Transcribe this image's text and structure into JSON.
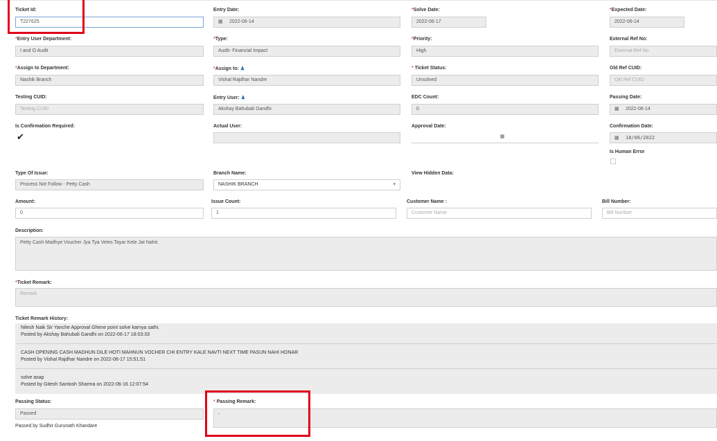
{
  "fields": {
    "ticket_id": {
      "label": "Ticket Id:",
      "value": "T227625"
    },
    "entry_date": {
      "label": "Entry Date:",
      "value": "2022-06-14"
    },
    "solve_date": {
      "label": "Solve Date:",
      "value": "2022-06-17"
    },
    "expected_date": {
      "label": "Expected Date:",
      "value": "2022-06-14"
    },
    "entry_user_department": {
      "label": "Entry User Department:",
      "value": "I and O Audit"
    },
    "type": {
      "label": "Type:",
      "value": "Audit- Financial Impact"
    },
    "priority": {
      "label": "Priority:",
      "value": "High"
    },
    "external_ref_no": {
      "label": "External Ref No:",
      "placeholder": "External Ref No."
    },
    "assign_to_department": {
      "label": "Assign to Department:",
      "value": "Nashik Branch"
    },
    "assign_to": {
      "label": "Assign to:",
      "value": "Vishal Rajdhar Nandre"
    },
    "ticket_status": {
      "label": "Ticket Status:",
      "value": "Unsolved"
    },
    "old_ref_cuid": {
      "label": "Old Ref CUID:",
      "placeholder": "Old Ref CUID"
    },
    "testing_cuid": {
      "label": "Testing CUID:",
      "placeholder": "Testing CUID"
    },
    "entry_user": {
      "label": "Entry User:",
      "value": "Akshay Bahubali Gandhi"
    },
    "edc_count": {
      "label": "EDC Count:",
      "value": "0"
    },
    "passing_date": {
      "label": "Passing Date:",
      "value": "2022-06-14"
    },
    "is_confirmation_required": {
      "label": "Is Confirmation Required:"
    },
    "actual_user": {
      "label": "Actual User:",
      "value": ""
    },
    "approval_date": {
      "label": "Approval Date:",
      "value": ""
    },
    "confirmation_date": {
      "label": "Confirmation Date:",
      "value": "18/06/2022"
    },
    "is_human_error": {
      "label": "Is Human Error"
    },
    "type_of_issue": {
      "label": "Type Of Issue:",
      "value": "Process Not Follow - Petty Cash"
    },
    "branch_name": {
      "label": "Branch Name:",
      "value": "NASHIK BRANCH"
    },
    "view_hidden_data": {
      "label": "View Hidden Data:"
    },
    "amount": {
      "label": "Amount:",
      "value": "0"
    },
    "issue_count": {
      "label": "Issue Count:",
      "value": "1"
    },
    "customer_name": {
      "label": "Customer Name :",
      "placeholder": "Customer Name"
    },
    "bill_number": {
      "label": "Bill Number:",
      "placeholder": "Bill Number"
    },
    "description": {
      "label": "Description:",
      "value": "Petty Cash Madhye Voucher Jya Tya Veles Tayar Kele Jat Nahit."
    },
    "ticket_remark": {
      "label": "Ticket Remark:",
      "placeholder": "Remark"
    },
    "passing_status": {
      "label": "Passing Status:",
      "value": "Passed",
      "note": "Passed by Sudhir Gurunath Khandare"
    },
    "passing_remark": {
      "label": "Passing Remark:",
      "value": "-"
    }
  },
  "remark_history": {
    "label": "Ticket Remark History:",
    "items": [
      {
        "text": "Nilesh Naik Sir Yanche Approval Ghene point solve karnya sathi.",
        "posted": "Posted by Akshay Bahubali Gandhi on 2022-06-17 18:03:33"
      },
      {
        "text": "CASH OPENING CASH MADHUN DILE HOTI MAHNUN VOCHER CHI ENTRY KALE NAVTI NEXT TIME PASUN NAHI HONAR",
        "posted": "Posted by Vishal Rajdhar Nandre on 2022-06-17 15:51:51"
      },
      {
        "text": "solve asap",
        "posted": "Posted by Gitesh Santosh Sharma on 2022-06-16 12:07:54"
      }
    ]
  },
  "colors": {
    "highlight_box": "#e0001a",
    "required": "#d9534f",
    "input_bg": "#ececec"
  }
}
